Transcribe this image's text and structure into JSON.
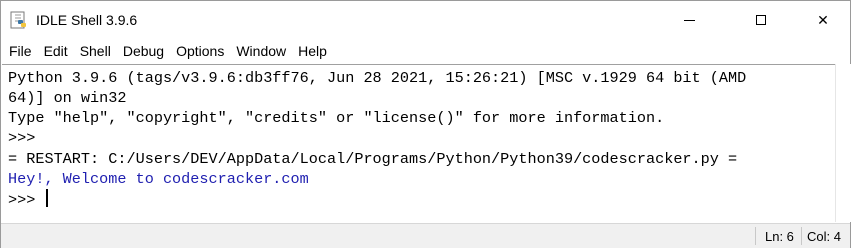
{
  "window": {
    "title": "IDLE Shell 3.9.6",
    "minimize_icon": "minimize-icon",
    "maximize_icon": "maximize-icon",
    "close_label": "✕"
  },
  "menu": {
    "items": [
      "File",
      "Edit",
      "Shell",
      "Debug",
      "Options",
      "Window",
      "Help"
    ]
  },
  "shell": {
    "lines": [
      "Python 3.9.6 (tags/v3.9.6:db3ff76, Jun 28 2021, 15:26:21) [MSC v.1929 64 bit (AMD",
      "64)] on win32",
      "Type \"help\", \"copyright\", \"credits\" or \"license()\" for more information.",
      ">>> ",
      "= RESTART: C:/Users/DEV/AppData/Local/Programs/Python/Python39/codescracker.py =",
      "Hey!, Welcome to codescracker.com",
      ">>> "
    ],
    "output_color": "#1f1fb0"
  },
  "status": {
    "line": "Ln: 6",
    "col": "Col: 4"
  }
}
